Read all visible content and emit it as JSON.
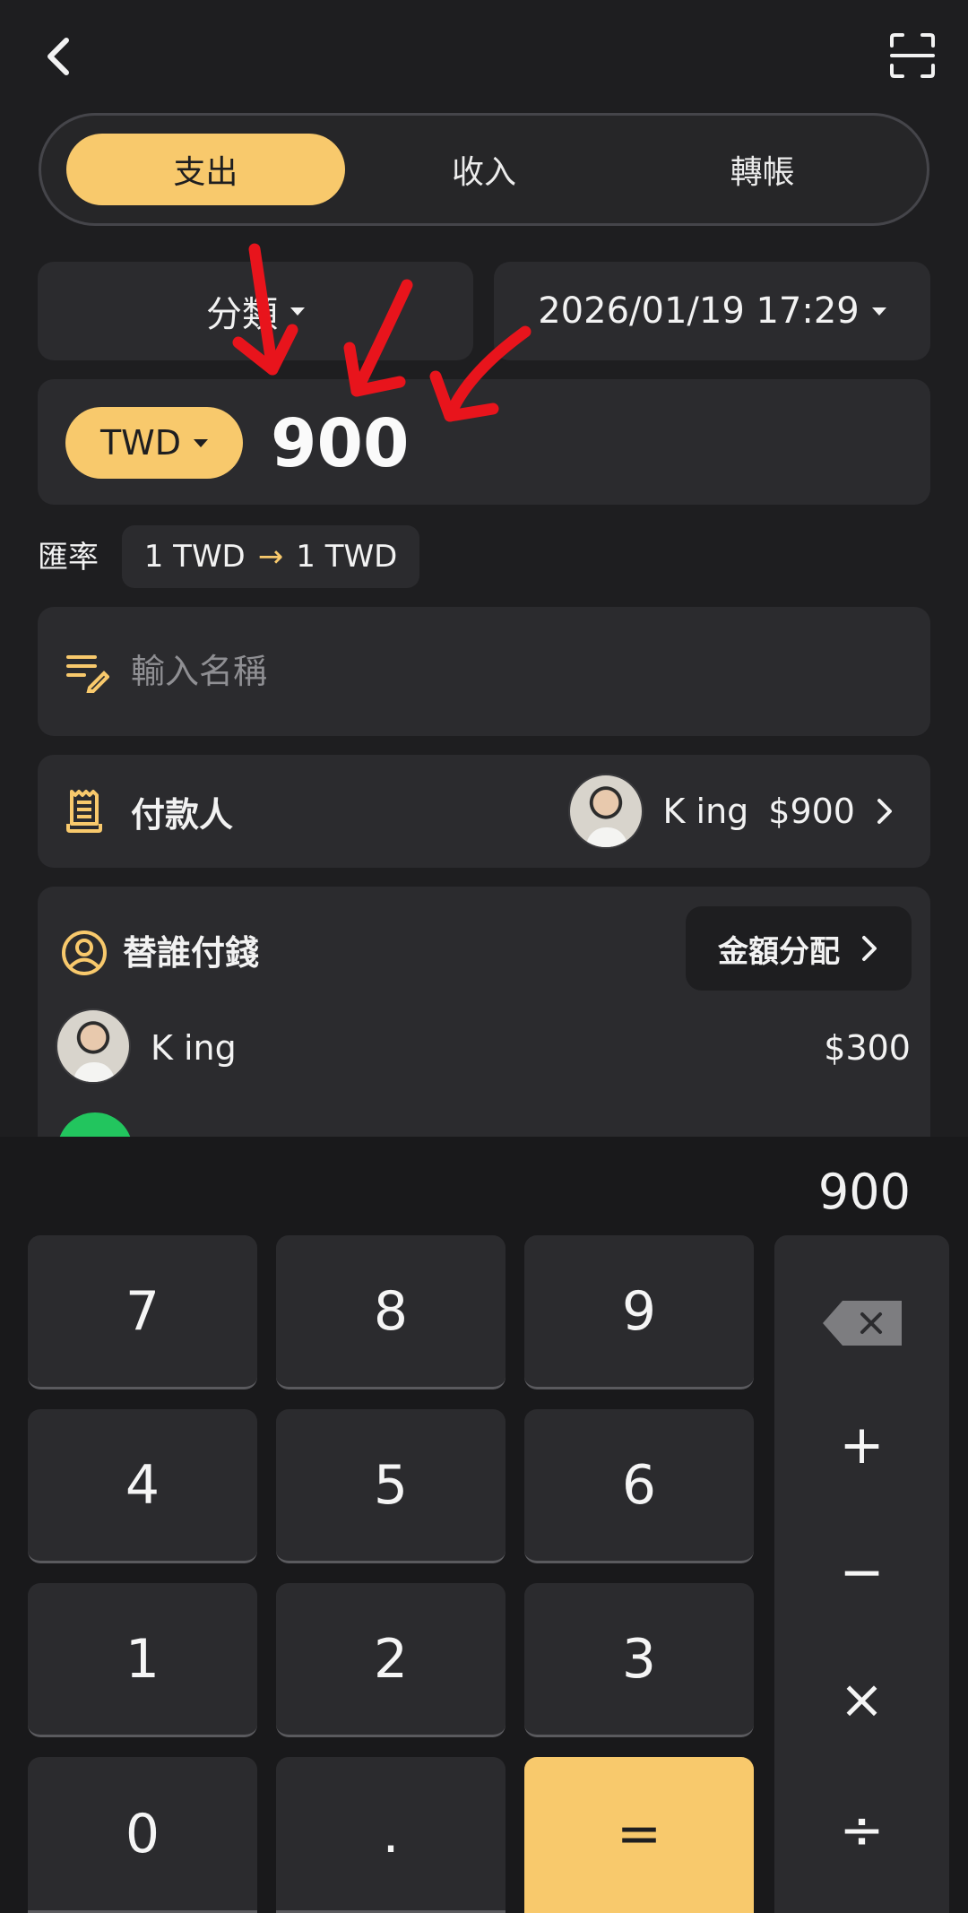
{
  "type_tabs": [
    {
      "label": "支出",
      "active": true
    },
    {
      "label": "收入",
      "active": false
    },
    {
      "label": "轉帳",
      "active": false
    }
  ],
  "category_label": "分類",
  "datetime": "2026/01/19 17:29",
  "amount": {
    "currency": "TWD",
    "value": "900"
  },
  "exchange_rate": {
    "label": "匯率",
    "from": "1 TWD",
    "to": "1 TWD"
  },
  "name_input": {
    "placeholder": "輸入名稱",
    "value": ""
  },
  "payer": {
    "label": "付款人",
    "name": "K ing",
    "amount": "$900"
  },
  "split": {
    "title": "替誰付錢",
    "allocation_button": "金額分配",
    "members": [
      {
        "name": "K ing",
        "amount": "$300"
      }
    ]
  },
  "keypad": {
    "display": "900",
    "keys": [
      "7",
      "8",
      "9",
      "4",
      "5",
      "6",
      "1",
      "2",
      "3",
      "0",
      ".",
      "="
    ],
    "operators": [
      "+",
      "−",
      "×",
      "÷"
    ]
  },
  "colors": {
    "accent": "#f8c96c",
    "background": "#1e1e20",
    "card": "#2b2b2e",
    "annotation": "#e8141c"
  }
}
